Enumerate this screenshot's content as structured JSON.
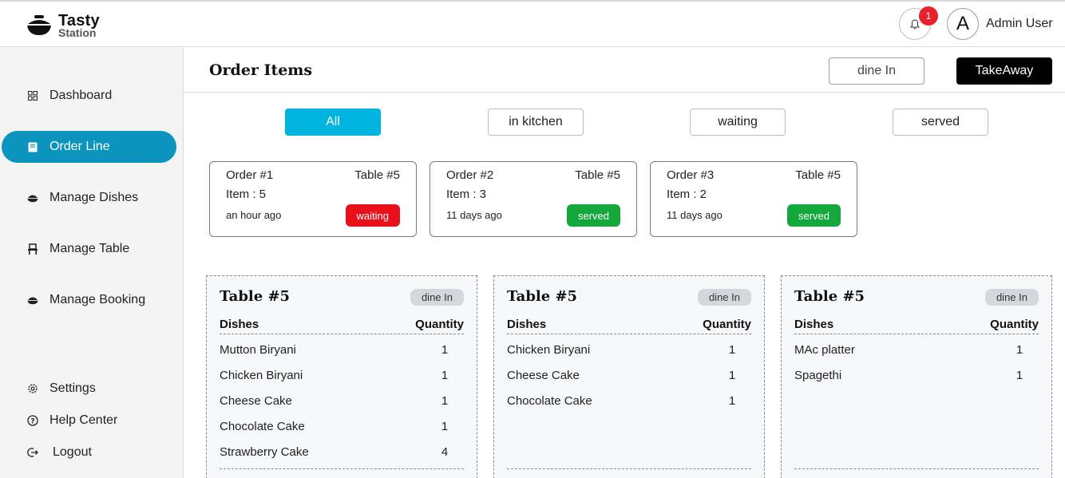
{
  "header": {
    "brand_title": "Tasty",
    "brand_subtitle": "Station",
    "notification_count": "1",
    "avatar_letter": "A",
    "user_name": "Admin User"
  },
  "sidebar": {
    "items": [
      {
        "label": "Dashboard",
        "icon": "grid-icon"
      },
      {
        "label": "Order Line",
        "icon": "book-icon",
        "active": true
      },
      {
        "label": "Manage Dishes",
        "icon": "bowl-icon"
      },
      {
        "label": "Manage Table",
        "icon": "chair-icon"
      },
      {
        "label": "Manage Booking",
        "icon": "bowl-icon"
      }
    ],
    "bottom_items": [
      {
        "label": "Settings",
        "icon": "gear-icon"
      },
      {
        "label": "Help Center",
        "icon": "help-icon"
      },
      {
        "label": "Logout",
        "icon": "logout-icon"
      }
    ]
  },
  "main": {
    "title": "Order Items",
    "modes": {
      "dine_in": "dine In",
      "takeaway": "TakeAway"
    },
    "filters": [
      "All",
      "in kitchen",
      "waiting",
      "served"
    ],
    "orders": [
      {
        "order": "Order #1",
        "table": "Table #5",
        "items": "Item : 5",
        "time": "an hour ago",
        "status": "waiting"
      },
      {
        "order": "Order #2",
        "table": "Table #5",
        "items": "Item : 3",
        "time": "11 days ago",
        "status": "served"
      },
      {
        "order": "Order #3",
        "table": "Table #5",
        "items": "Item : 2",
        "time": "11 days ago",
        "status": "served"
      }
    ],
    "table_cards": [
      {
        "title": "Table #5",
        "type": "dine In",
        "col_dishes": "Dishes",
        "col_quantity": "Quantity",
        "rows": [
          {
            "dish": "Mutton Biryani",
            "qty": "1"
          },
          {
            "dish": "Chicken Biryani",
            "qty": "1"
          },
          {
            "dish": "Cheese Cake",
            "qty": "1"
          },
          {
            "dish": "Chocolate Cake",
            "qty": "1"
          },
          {
            "dish": "Strawberry Cake",
            "qty": "4"
          }
        ]
      },
      {
        "title": "Table #5",
        "type": "dine In",
        "col_dishes": "Dishes",
        "col_quantity": "Quantity",
        "rows": [
          {
            "dish": "Chicken Biryani",
            "qty": "1"
          },
          {
            "dish": "Cheese Cake",
            "qty": "1"
          },
          {
            "dish": "Chocolate Cake",
            "qty": "1"
          }
        ]
      },
      {
        "title": "Table #5",
        "type": "dine In",
        "col_dishes": "Dishes",
        "col_quantity": "Quantity",
        "rows": [
          {
            "dish": "MAc platter",
            "qty": "1"
          },
          {
            "dish": "Spagethi",
            "qty": "1"
          }
        ]
      }
    ]
  },
  "colors": {
    "active_nav": "#0b94bd",
    "active_filter": "#00b4e0",
    "waiting": "#e8101a",
    "served": "#14a83c",
    "badge": "#e8202a"
  }
}
